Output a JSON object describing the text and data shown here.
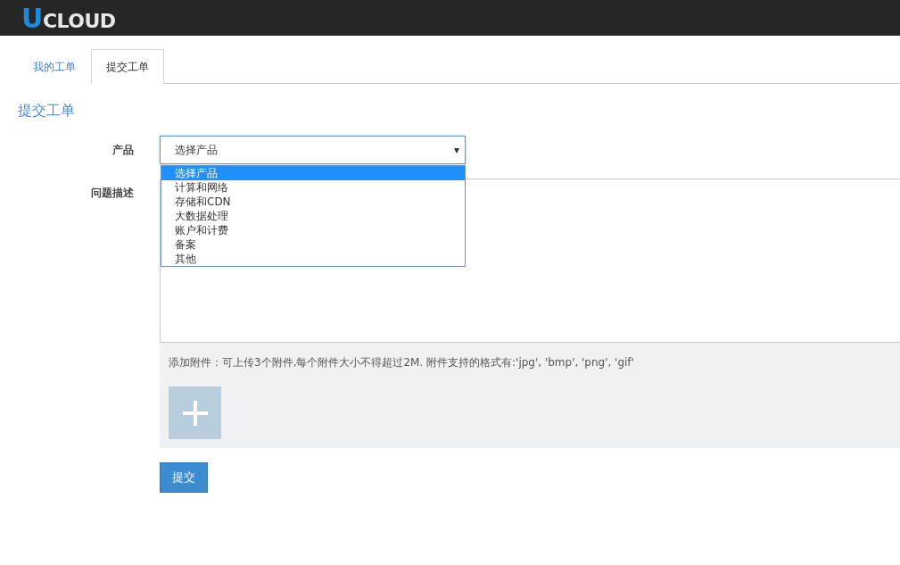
{
  "header": {
    "logo": "UCLOUD"
  },
  "tabs": [
    {
      "label": "我的工单",
      "selected": false
    },
    {
      "label": "提交工单",
      "selected": true
    }
  ],
  "heading": "提交工单",
  "form": {
    "product": {
      "label": "产品",
      "value": "选择产品",
      "caret": "▾",
      "expanded": true,
      "options": [
        {
          "label": "选择产品",
          "selected": true
        },
        {
          "label": "计算和网络",
          "selected": false
        },
        {
          "label": "存储和CDN",
          "selected": false
        },
        {
          "label": "大数据处理",
          "selected": false
        },
        {
          "label": "账户和计费",
          "selected": false
        },
        {
          "label": "备案",
          "selected": false
        },
        {
          "label": "其他",
          "selected": false
        }
      ]
    },
    "description": {
      "label": "问题描述"
    },
    "attachments": {
      "hint": "添加附件：可上传3个附件,每个附件大小不得超过2M. 附件支持的格式有:'jpg', 'bmp', 'png', 'gif'"
    },
    "submit": "提交"
  }
}
